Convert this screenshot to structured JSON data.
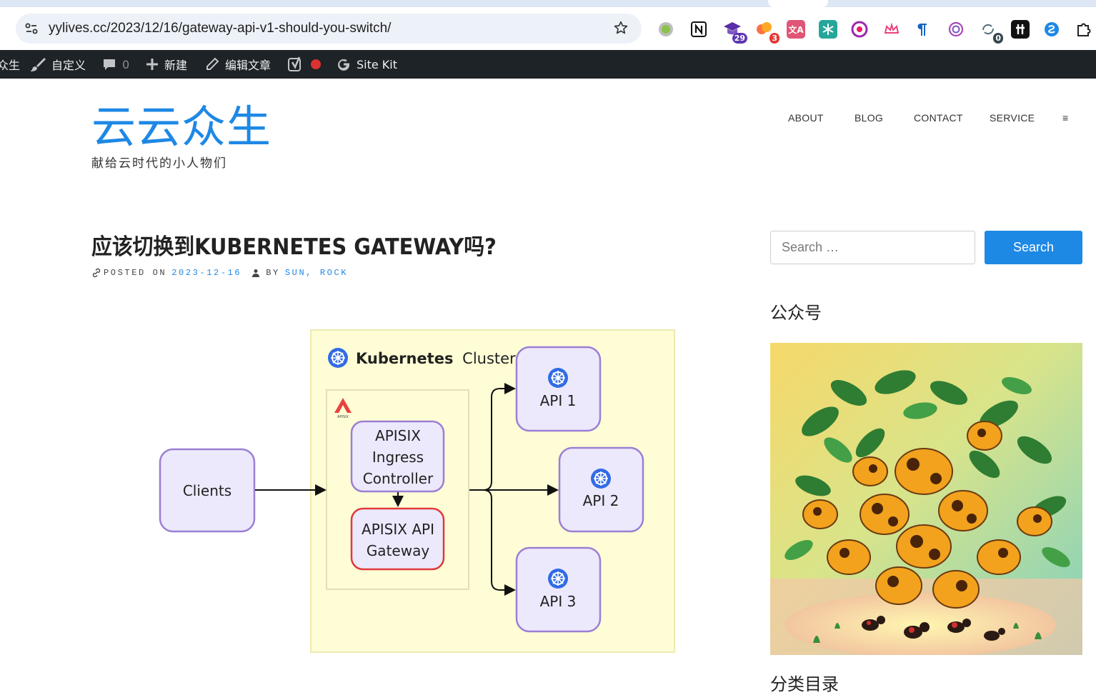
{
  "browser": {
    "url": "yylives.cc/2023/12/16/gateway-api-v1-should-you-switch/",
    "extensions": [
      {
        "icon": "green-circle-icon",
        "badge": ""
      },
      {
        "icon": "notion-icon",
        "badge": ""
      },
      {
        "icon": "graduation-cap-icon",
        "badge": "29"
      },
      {
        "icon": "cloud-icon",
        "badge": "3"
      },
      {
        "icon": "translate-icon",
        "badge": ""
      },
      {
        "icon": "snowflake-icon",
        "badge": ""
      },
      {
        "icon": "lr-icon",
        "badge": ""
      },
      {
        "icon": "crown-icon",
        "badge": ""
      },
      {
        "icon": "pilcrow-icon",
        "badge": ""
      },
      {
        "icon": "openai-icon",
        "badge": ""
      },
      {
        "icon": "sync-icon",
        "badge": "0"
      },
      {
        "icon": "hashnode-icon",
        "badge": ""
      },
      {
        "icon": "blue-circle-icon",
        "badge": ""
      },
      {
        "icon": "puzzle-icon",
        "badge": ""
      }
    ]
  },
  "adminbar": {
    "site_partial": "众生",
    "customize": "自定义",
    "comments_count": "0",
    "new": "新建",
    "edit_post": "编辑文章",
    "sitekit": "Site Kit"
  },
  "site": {
    "title": "云云众生",
    "description": "献给云时代的小人物们"
  },
  "nav": {
    "items": [
      "ABOUT",
      "BLOG",
      "CONTACT",
      "SERVICE",
      "≡"
    ]
  },
  "post": {
    "title": "应该切换到KUBERNETES GATEWAY吗?",
    "posted_on_label": "POSTED ON",
    "date": "2023-12-16",
    "by_label": "BY",
    "author": "SUN, ROCK"
  },
  "diagram": {
    "cluster_title_bold": "Kubernetes",
    "cluster_title_rest": "Cluster",
    "apisix_logo_text": "APISIX",
    "clients": "Clients",
    "ingress_line1": "APISIX",
    "ingress_line2": "Ingress",
    "ingress_line3": "Controller",
    "gateway_line1": "APISIX API",
    "gateway_line2": "Gateway",
    "api1": "API 1",
    "api2": "API 2",
    "api3": "API 3"
  },
  "sidebar": {
    "search_placeholder": "Search …",
    "search_button": "Search",
    "widget_title": "公众号",
    "next_widget_title": "分类目录"
  },
  "colors": {
    "accent": "#1e88e5",
    "adminbar": "#1d2327",
    "cluster_bg": "#fffdd6",
    "node_fill": "#ece9fd",
    "node_border": "#9b7fd4",
    "gateway_border": "#e03a3a"
  }
}
